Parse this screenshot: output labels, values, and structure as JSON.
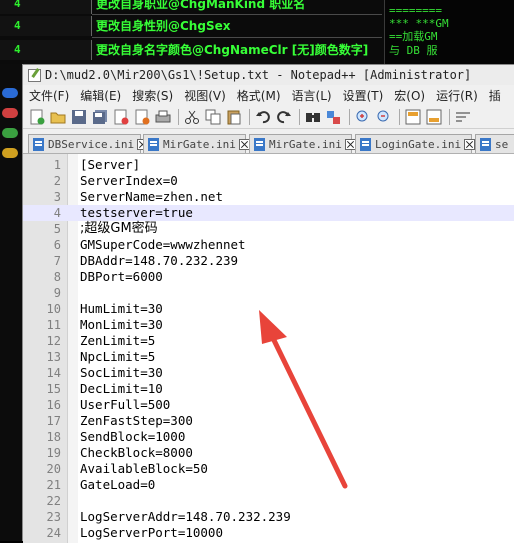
{
  "background": {
    "rows": [
      {
        "num": "4",
        "text": "更改自身职业@ChgManKind 职业名"
      },
      {
        "num": "4",
        "text": "更改自身性别@ChgSex"
      },
      {
        "num": "4",
        "text": "更改自身名字颜色@ChgNameClr [无]颜色数字]"
      }
    ],
    "right_lines": [
      "========",
      "*** ***GM",
      "==加载GM",
      "与 DB 服"
    ]
  },
  "window": {
    "title": "D:\\mud2.0\\Mir200\\Gs1\\!Setup.txt - Notepad++ [Administrator]"
  },
  "menu": [
    "文件(F)",
    "编辑(E)",
    "搜索(S)",
    "视图(V)",
    "格式(M)",
    "语言(L)",
    "设置(T)",
    "宏(O)",
    "运行(R)",
    "插"
  ],
  "tabs": [
    "DBService.ini",
    "MirGate.ini",
    "MirGate.ini",
    "LoginGate.ini",
    "se"
  ],
  "editor": {
    "current_line": 4,
    "lines": [
      {
        "n": "1",
        "text": "[Server]"
      },
      {
        "n": "2",
        "text": "ServerIndex=0"
      },
      {
        "n": "3",
        "text": "ServerName=zhen.net"
      },
      {
        "n": "4",
        "text": "testserver=true"
      },
      {
        "n": "5",
        "text": ";超级GM密码"
      },
      {
        "n": "6",
        "text": "GMSuperCode=wwwzhennet"
      },
      {
        "n": "7",
        "text": "DBAddr=148.70.232.239"
      },
      {
        "n": "8",
        "text": "DBPort=6000"
      },
      {
        "n": "9",
        "text": ""
      },
      {
        "n": "10",
        "text": "HumLimit=30"
      },
      {
        "n": "11",
        "text": "MonLimit=30"
      },
      {
        "n": "12",
        "text": "ZenLimit=5"
      },
      {
        "n": "13",
        "text": "NpcLimit=5"
      },
      {
        "n": "14",
        "text": "SocLimit=30"
      },
      {
        "n": "15",
        "text": "DecLimit=10"
      },
      {
        "n": "16",
        "text": "UserFull=500"
      },
      {
        "n": "17",
        "text": "ZenFastStep=300"
      },
      {
        "n": "18",
        "text": "SendBlock=1000"
      },
      {
        "n": "19",
        "text": "CheckBlock=8000"
      },
      {
        "n": "20",
        "text": "AvailableBlock=50"
      },
      {
        "n": "21",
        "text": "GateLoad=0"
      },
      {
        "n": "22",
        "text": ""
      },
      {
        "n": "23",
        "text": "LogServerAddr=148.70.232.239"
      },
      {
        "n": "24",
        "text": "LogServerPort=10000"
      }
    ]
  },
  "colors": {
    "arrow": "#e8443a",
    "background_text": "#37ff37",
    "current_line": "#e8e8ff"
  }
}
